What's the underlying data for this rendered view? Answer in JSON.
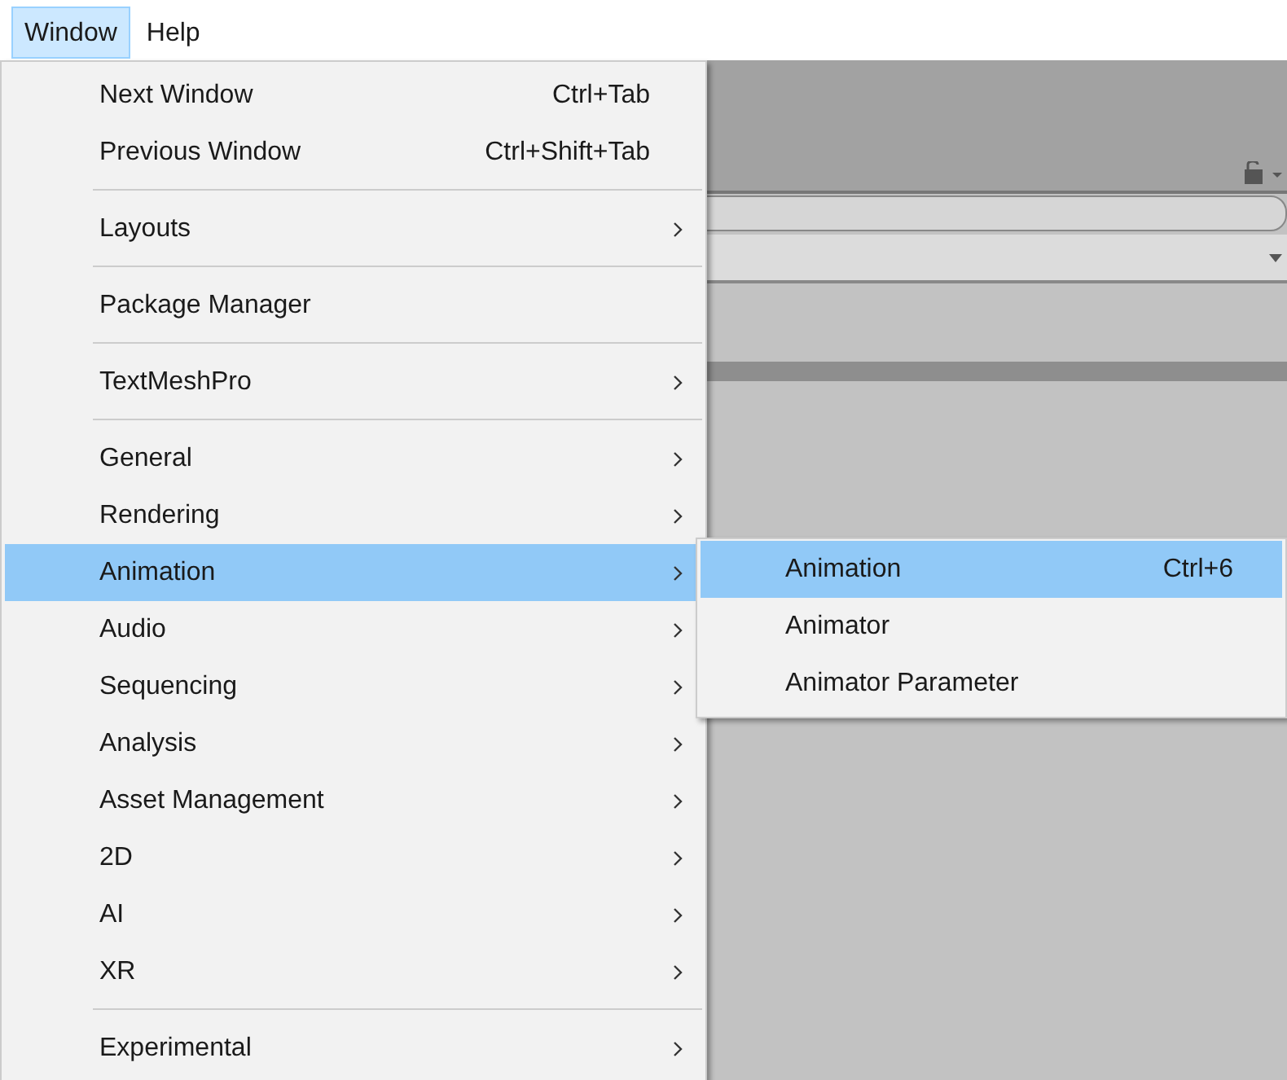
{
  "menubar": [
    {
      "label": "Window",
      "selected": true
    },
    {
      "label": "Help",
      "selected": false
    }
  ],
  "menu": [
    {
      "kind": "item",
      "label": "Next Window",
      "shortcut": "Ctrl+Tab",
      "submenu": false,
      "selected": false
    },
    {
      "kind": "item",
      "label": "Previous Window",
      "shortcut": "Ctrl+Shift+Tab",
      "submenu": false,
      "selected": false
    },
    {
      "kind": "separator"
    },
    {
      "kind": "item",
      "label": "Layouts",
      "submenu": true,
      "selected": false
    },
    {
      "kind": "separator"
    },
    {
      "kind": "item",
      "label": "Package Manager",
      "submenu": false,
      "selected": false
    },
    {
      "kind": "separator"
    },
    {
      "kind": "item",
      "label": "TextMeshPro",
      "submenu": true,
      "selected": false
    },
    {
      "kind": "separator"
    },
    {
      "kind": "item",
      "label": "General",
      "submenu": true,
      "selected": false
    },
    {
      "kind": "item",
      "label": "Rendering",
      "submenu": true,
      "selected": false
    },
    {
      "kind": "item",
      "label": "Animation",
      "submenu": true,
      "selected": true
    },
    {
      "kind": "item",
      "label": "Audio",
      "submenu": true,
      "selected": false
    },
    {
      "kind": "item",
      "label": "Sequencing",
      "submenu": true,
      "selected": false
    },
    {
      "kind": "item",
      "label": "Analysis",
      "submenu": true,
      "selected": false
    },
    {
      "kind": "item",
      "label": "Asset Management",
      "submenu": true,
      "selected": false
    },
    {
      "kind": "item",
      "label": "2D",
      "submenu": true,
      "selected": false
    },
    {
      "kind": "item",
      "label": "AI",
      "submenu": true,
      "selected": false
    },
    {
      "kind": "item",
      "label": "XR",
      "submenu": true,
      "selected": false
    },
    {
      "kind": "separator"
    },
    {
      "kind": "item",
      "label": "Experimental",
      "submenu": true,
      "selected": false
    }
  ],
  "submenu": [
    {
      "label": "Animation",
      "shortcut": "Ctrl+6",
      "selected": true
    },
    {
      "label": "Animator",
      "selected": false
    },
    {
      "label": "Animator Parameter",
      "selected": false
    }
  ]
}
